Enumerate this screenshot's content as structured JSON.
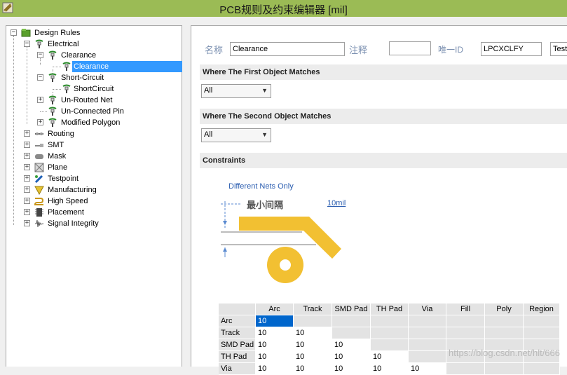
{
  "window": {
    "title": "PCB规则及约束编辑器 [mil]"
  },
  "tree": {
    "root": "Design Rules",
    "electrical": "Electrical",
    "clearance": "Clearance",
    "clearance_child": "Clearance",
    "short_circuit": "Short-Circuit",
    "short_circuit_child": "ShortCircuit",
    "unrouted_net": "Un-Routed Net",
    "unconnected_pin": "Un-Connected Pin",
    "modified_polygon": "Modified Polygon",
    "routing": "Routing",
    "smt": "SMT",
    "mask": "Mask",
    "plane": "Plane",
    "testpoint": "Testpoint",
    "manufacturing": "Manufacturing",
    "high_speed": "High Speed",
    "placement": "Placement",
    "signal_integrity": "Signal Integrity"
  },
  "form": {
    "name_label": "名称",
    "name_value": "Clearance",
    "comment_label": "注释",
    "comment_value": "",
    "uid_label": "唯一ID",
    "uid_value": "LPCXCLFY",
    "test_label": "Test"
  },
  "sections": {
    "first": "Where The First Object Matches",
    "first_value": "All",
    "second": "Where The Second Object Matches",
    "second_value": "All",
    "constraints": "Constraints"
  },
  "constraints": {
    "different_nets": "Different Nets Only",
    "min_clearance_label": "最小间隔",
    "min_clearance_value": "10mil"
  },
  "grid": {
    "columns": [
      "Arc",
      "Track",
      "SMD Pad",
      "TH Pad",
      "Via",
      "Fill",
      "Poly",
      "Region"
    ],
    "rows": [
      {
        "label": "Arc",
        "values": [
          "10"
        ]
      },
      {
        "label": "Track",
        "values": [
          "10",
          "10"
        ]
      },
      {
        "label": "SMD Pad",
        "values": [
          "10",
          "10",
          "10"
        ]
      },
      {
        "label": "TH Pad",
        "values": [
          "10",
          "10",
          "10",
          "10"
        ]
      },
      {
        "label": "Via",
        "values": [
          "10",
          "10",
          "10",
          "10",
          "10"
        ]
      }
    ]
  },
  "watermark": "https://blog.csdn.net/hlt/666",
  "colors": {
    "titlebar": "#9bbb55",
    "selection": "#3399ff",
    "pad": "#f2c032"
  }
}
